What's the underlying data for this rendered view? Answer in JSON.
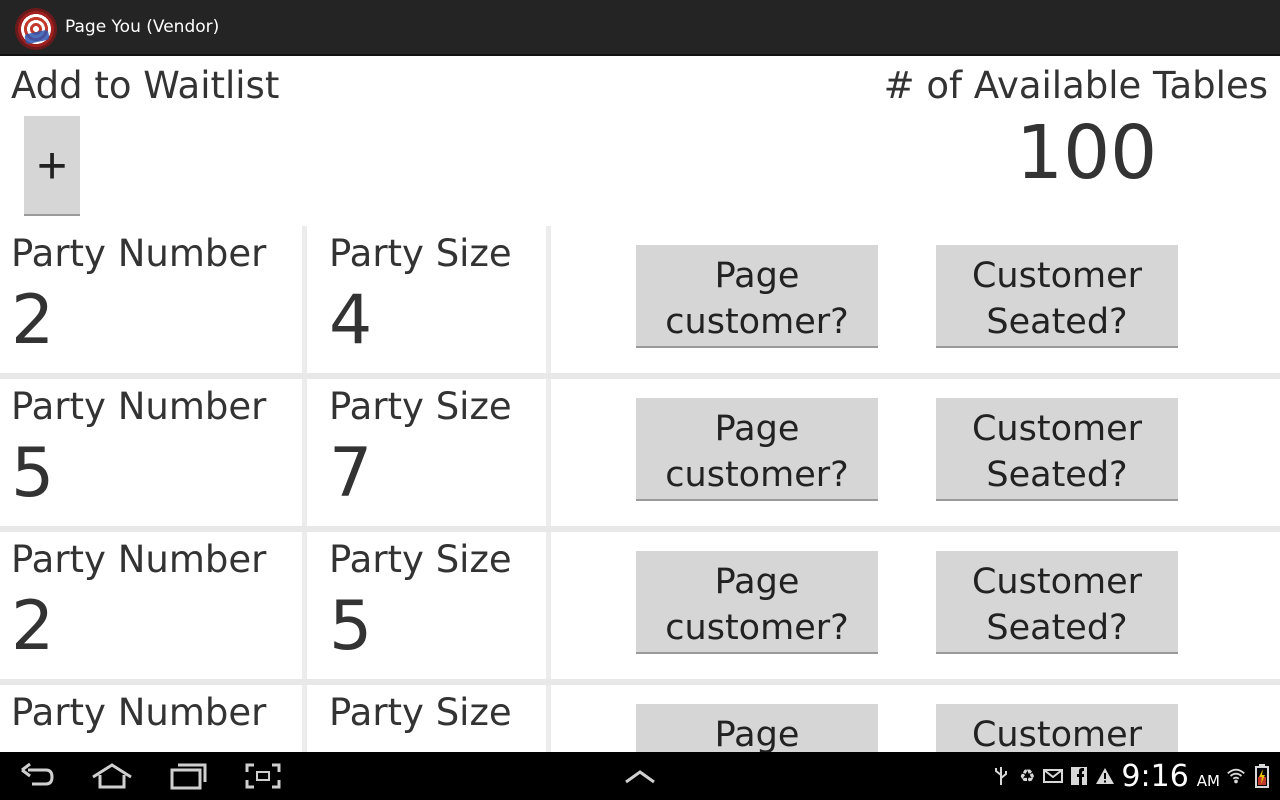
{
  "app": {
    "title": "Page You (Vendor)",
    "icon": "app-logo-icon"
  },
  "header": {
    "waitlist_label": "Add to Waitlist",
    "add_button_label": "+",
    "tables_label": "# of Available Tables",
    "tables_count": "100"
  },
  "parties": [
    {
      "number_label": "Party Number",
      "number": "2",
      "size_label": "Party Size",
      "size": "4",
      "page_label": "Page customer?",
      "seated_label": "Customer Seated?"
    },
    {
      "number_label": "Party Number",
      "number": "5",
      "size_label": "Party Size",
      "size": "7",
      "page_label": "Page customer?",
      "seated_label": "Customer Seated?"
    },
    {
      "number_label": "Party Number",
      "number": "2",
      "size_label": "Party Size",
      "size": "5",
      "page_label": "Page customer?",
      "seated_label": "Customer Seated?"
    },
    {
      "number_label": "Party Number",
      "number": "",
      "size_label": "Party Size",
      "size": "",
      "page_label": "Page customer?",
      "seated_label": "Customer Seated?"
    }
  ],
  "nav": {
    "back": "back-icon",
    "home": "home-icon",
    "recents": "recent-apps-icon",
    "screenshot": "screenshot-icon",
    "up": "chevron-up-icon"
  },
  "status": {
    "icons": [
      "usb-icon",
      "recycle-icon",
      "email-icon",
      "facebook-icon",
      "warning-icon"
    ],
    "time": "9:16",
    "ampm": "AM",
    "wifi": "wifi-icon",
    "battery": "battery-icon"
  },
  "colors": {
    "action_bar": "#242424",
    "button_bg": "#d6d6d6",
    "nav_bar": "#000000",
    "text": "#333333"
  }
}
